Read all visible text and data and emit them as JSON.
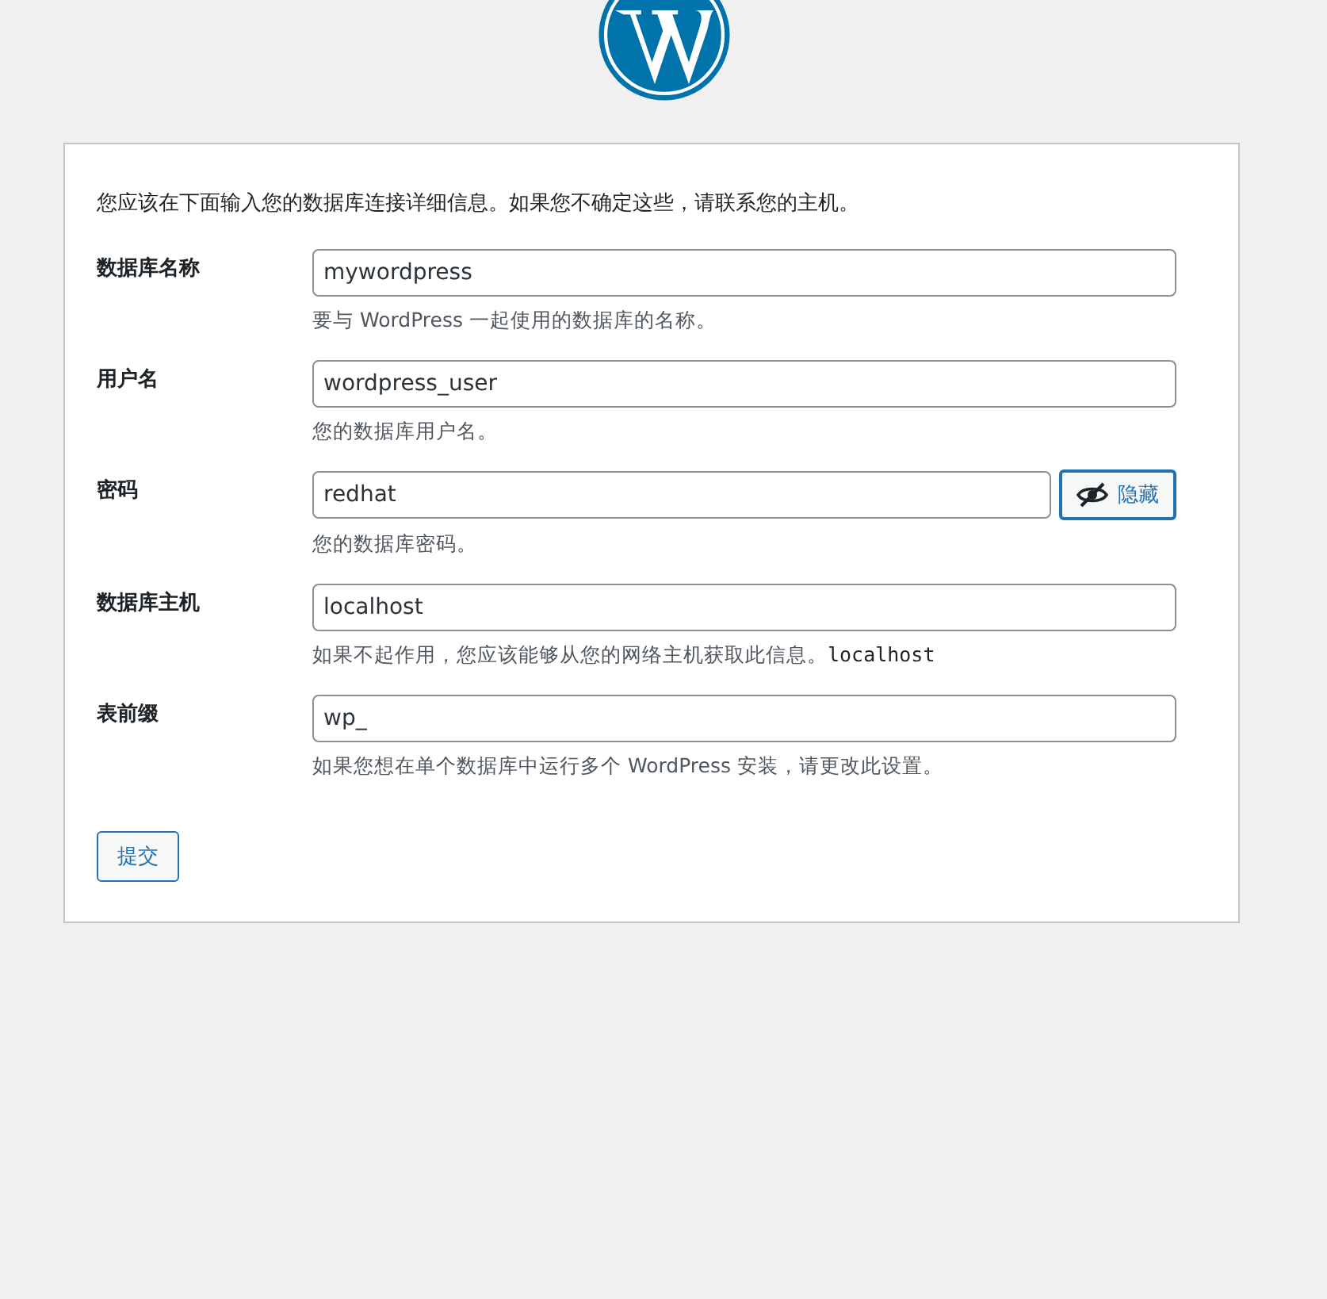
{
  "intro": "您应该在下面输入您的数据库连接详细信息。如果您不确定这些，请联系您的主机。",
  "fields": [
    {
      "kind": "text",
      "label": "数据库名称",
      "value": "mywordpress",
      "help": "要与 WordPress 一起使用的数据库的名称。"
    },
    {
      "kind": "text",
      "label": "用户名",
      "value": "wordpress_user",
      "help": "您的数据库用户名。"
    },
    {
      "kind": "password",
      "label": "密码",
      "value": "redhat",
      "toggle_label": "隐藏",
      "help": "您的数据库密码。"
    },
    {
      "kind": "text",
      "label": "数据库主机",
      "value": "localhost",
      "help": "如果不起作用，您应该能够从您的网络主机获取此信息。",
      "help_code": "localhost"
    },
    {
      "kind": "text",
      "label": "表前缀",
      "value": "wp_",
      "help": "如果您想在单个数据库中运行多个 WordPress 安装，请更改此设置。"
    }
  ],
  "submit": "提交"
}
